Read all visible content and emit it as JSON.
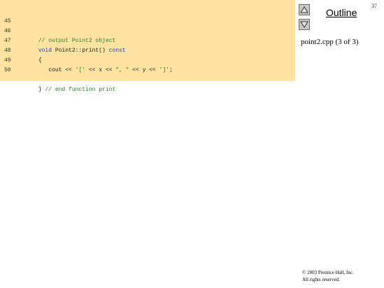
{
  "slide_number": "37",
  "outline_title": "Outline",
  "file_label": "point2.cpp (3 of 3)",
  "copyright": {
    "line1": "© 2003 Prentice Hall, Inc.",
    "line2": "All rights reserved."
  },
  "icons": {
    "up": "triangle-up-icon",
    "down": "triangle-down-icon"
  },
  "colors": {
    "code_background": "#ffe3a0",
    "comment": "#2d7a2d",
    "keyword": "#1d3fa6"
  },
  "code_lines": [
    {
      "number": "45",
      "parts": [
        {
          "text": "// output Point2 object",
          "type": "comment"
        }
      ]
    },
    {
      "number": "46",
      "parts": [
        {
          "text": "void",
          "type": "kw"
        },
        {
          "text": " Point2::print() ",
          "type": "plain"
        },
        {
          "text": "const",
          "type": "kw"
        }
      ]
    },
    {
      "number": "47",
      "parts": [
        {
          "text": "{",
          "type": "plain"
        }
      ]
    },
    {
      "number": "48",
      "parts": [
        {
          "text": "   cout << ",
          "type": "plain"
        },
        {
          "text": "'['",
          "type": "str"
        },
        {
          "text": " << x << ",
          "type": "plain"
        },
        {
          "text": "\", \"",
          "type": "str"
        },
        {
          "text": " << y << ",
          "type": "plain"
        },
        {
          "text": "']'",
          "type": "str"
        },
        {
          "text": ";",
          "type": "plain"
        }
      ]
    },
    {
      "number": "49",
      "parts": [
        {
          "text": "",
          "type": "plain"
        }
      ]
    },
    {
      "number": "50",
      "parts": [
        {
          "text": "} ",
          "type": "plain"
        },
        {
          "text": "// end function print",
          "type": "comment"
        }
      ]
    }
  ]
}
